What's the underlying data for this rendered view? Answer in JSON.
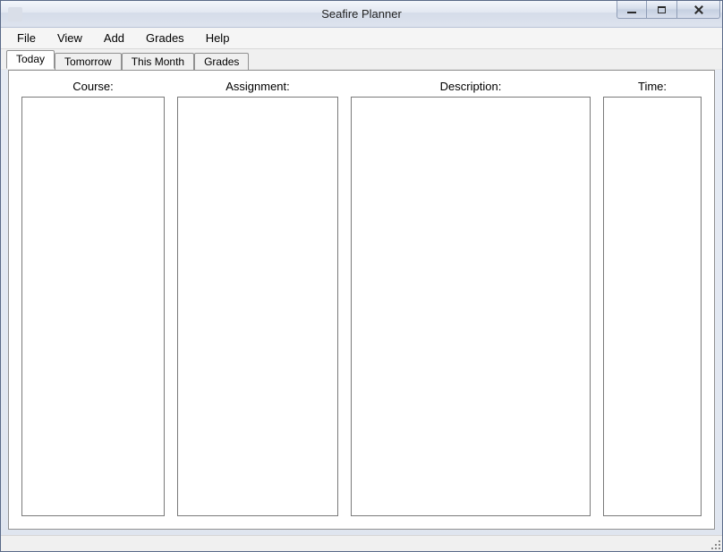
{
  "window": {
    "title": "Seafire Planner"
  },
  "menu": {
    "items": [
      "File",
      "View",
      "Add",
      "Grades",
      "Help"
    ]
  },
  "tabs": {
    "items": [
      "Today",
      "Tomorrow",
      "This Month",
      "Grades"
    ],
    "active_index": 0
  },
  "columns": {
    "course": {
      "label": "Course:"
    },
    "assignment": {
      "label": "Assignment:"
    },
    "description": {
      "label": "Description:"
    },
    "time": {
      "label": "Time:"
    }
  }
}
